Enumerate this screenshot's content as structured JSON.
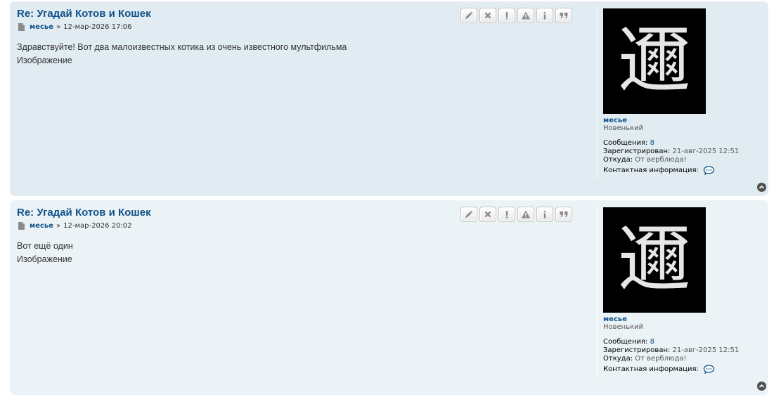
{
  "posts": [
    {
      "title": "Re: Угадай Котов и Кошек",
      "author": "месье",
      "separator": "»",
      "datetime": "12-мар-2026 17:06",
      "body_lines": [
        "Здравствуйте! Вот два малоизвестных котика из очень известного мультфильма",
        "Изображение"
      ],
      "profile": {
        "avatar_glyph": "邇",
        "username": "месье",
        "rank": "Новенький",
        "posts_label": "Сообщения:",
        "posts_value": "8",
        "registered_label": "Зарегистрирован:",
        "registered_value": "21-авг-2025 12:51",
        "from_label": "Откуда:",
        "from_value": "От верблюда!",
        "contact_label": "Контактная информация:"
      }
    },
    {
      "title": "Re: Угадай Котов и Кошек",
      "author": "месье",
      "separator": "»",
      "datetime": "12-мар-2026 20:02",
      "body_lines": [
        "Вот ещё один",
        "Изображение"
      ],
      "profile": {
        "avatar_glyph": "邇",
        "username": "месье",
        "rank": "Новенький",
        "posts_label": "Сообщения:",
        "posts_value": "8",
        "registered_label": "Зарегистрирован:",
        "registered_value": "21-авг-2025 12:51",
        "from_label": "Откуда:",
        "from_value": "От верблюда!",
        "contact_label": "Контактная информация:"
      }
    }
  ],
  "post_buttons": [
    {
      "icon": "pencil-icon",
      "name": "edit-button"
    },
    {
      "icon": "x-icon",
      "name": "delete-button"
    },
    {
      "icon": "exclamation-icon",
      "name": "report-button"
    },
    {
      "icon": "warning-icon",
      "name": "warn-button"
    },
    {
      "icon": "info-icon",
      "name": "info-button"
    },
    {
      "icon": "quote-icon",
      "name": "quote-button"
    }
  ],
  "colors": {
    "post_bg_1": "#e1ebf2",
    "post_bg_2": "#ecf3f7",
    "link": "#105289"
  }
}
